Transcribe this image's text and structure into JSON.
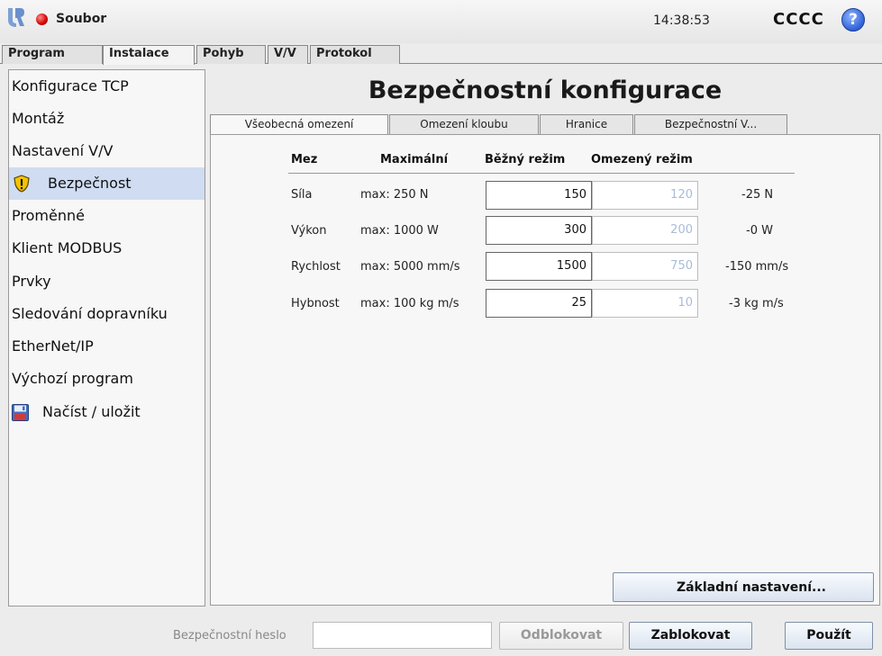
{
  "topbar": {
    "file_menu": "Soubor",
    "clock": "14:38:53",
    "robot_name": "CCCC",
    "help_glyph": "?",
    "icons": [
      "ur-logo-icon",
      "status-dot-icon",
      "help-icon"
    ]
  },
  "main_tabs": [
    "Program",
    "Instalace",
    "Pohyb",
    "V/V",
    "Protokol"
  ],
  "main_tab_active": "Instalace",
  "sidebar": {
    "items": [
      {
        "label": "Konfigurace TCP"
      },
      {
        "label": "Montáž"
      },
      {
        "label": "Nastavení V/V"
      },
      {
        "label": "Bezpečnost",
        "icon": "warning-shield-icon",
        "selected": true
      },
      {
        "label": "Proměnné"
      },
      {
        "label": "Klient MODBUS"
      },
      {
        "label": "Prvky"
      },
      {
        "label": "Sledování dopravníku"
      },
      {
        "label": "EtherNet/IP"
      },
      {
        "label": "Výchozí program"
      },
      {
        "label": "Načíst / uložit",
        "icon": "floppy-disk-icon"
      }
    ]
  },
  "content": {
    "title": "Bezpečnostní konfigurace",
    "sub_tabs": [
      "Všeobecná omezení",
      "Omezení kloubu",
      "Hranice",
      "Bezpečnostní V..."
    ],
    "sub_tab_active": "Všeobecná omezení",
    "table": {
      "headers": [
        "Mez",
        "Maximální",
        "Běžný režim",
        "Omezený režim"
      ],
      "rows": [
        {
          "limit": "Síla",
          "max": "max: 250 N",
          "normal": "150",
          "reduced": "120",
          "delta": "-25 N"
        },
        {
          "limit": "Výkon",
          "max": "max: 1000 W",
          "normal": "300",
          "reduced": "200",
          "delta": "-0 W"
        },
        {
          "limit": "Rychlost",
          "max": "max: 5000 mm/s",
          "normal": "1500",
          "reduced": "750",
          "delta": "-150 mm/s"
        },
        {
          "limit": "Hybnost",
          "max": "max: 100 kg m/s",
          "normal": "25",
          "reduced": "10",
          "delta": "-3 kg m/s"
        }
      ]
    },
    "defaults_button": "Základní nastavení..."
  },
  "bottombar": {
    "password_label": "Bezpečnostní heslo",
    "password_value": "",
    "unlock_button": "Odblokovat",
    "lock_button": "Zablokovat",
    "apply_button": "Použít"
  },
  "colors": {
    "selection": "#cfdcf2",
    "reduced_text": "#a9bcd8",
    "status_dot": "#d00000",
    "help_blue": "#2f62d6"
  }
}
